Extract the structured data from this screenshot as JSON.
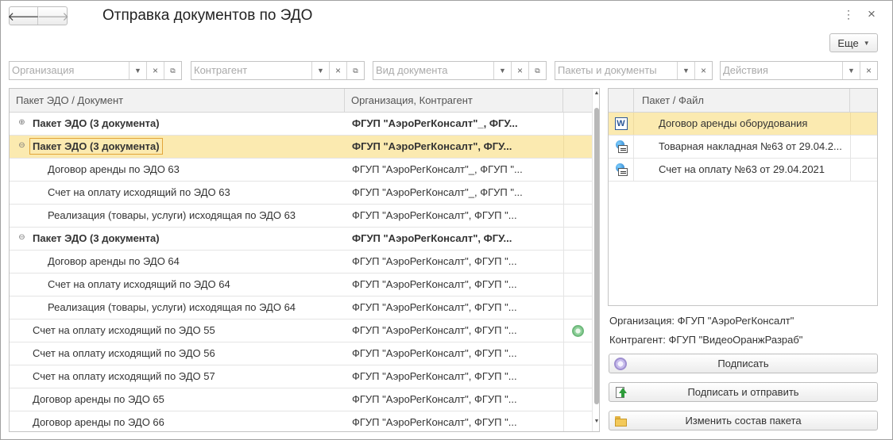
{
  "window": {
    "title": "Отправка документов по ЭДО",
    "back_icon": "🡐",
    "forward_icon": "🡒",
    "menu_icon": "⋮",
    "close_icon": "×"
  },
  "toolbar": {
    "more_label": "Еще",
    "more_caret": "▼"
  },
  "filters": [
    {
      "placeholder": "Организация",
      "has_open": true
    },
    {
      "placeholder": "Контрагент",
      "has_open": true
    },
    {
      "placeholder": "Вид документа",
      "has_open": true
    },
    {
      "placeholder": "Пакеты и документы",
      "has_open": false
    },
    {
      "placeholder": "Действия",
      "has_open": false
    }
  ],
  "filter_glyphs": {
    "dropdown": "▼",
    "clear": "×",
    "open": "⧉"
  },
  "main_table": {
    "columns": [
      "Пакет ЭДО / Документ",
      "Организация, Контрагент"
    ],
    "rows": [
      {
        "doc": "Пакет ЭДО (3 документа)",
        "org": "ФГУП \"АэроРегКонсалт\"_, ФГУ...",
        "level": 0,
        "bold": true,
        "expander": "⊕",
        "selected": false,
        "focused": false,
        "signed": false
      },
      {
        "doc": "Пакет ЭДО (3 документа)",
        "org": "ФГУП \"АэроРегКонсалт\", ФГУ...",
        "level": 0,
        "bold": true,
        "expander": "⊖",
        "selected": true,
        "focused": true,
        "signed": false
      },
      {
        "doc": "Договор аренды по ЭДО 63",
        "org": "ФГУП \"АэроРегКонсалт\"_, ФГУП \"...",
        "level": 2,
        "bold": false,
        "expander": "",
        "selected": false,
        "focused": false,
        "signed": false
      },
      {
        "doc": "Счет на оплату исходящий по ЭДО 63",
        "org": "ФГУП \"АэроРегКонсалт\"_, ФГУП \"...",
        "level": 2,
        "bold": false,
        "expander": "",
        "selected": false,
        "focused": false,
        "signed": false
      },
      {
        "doc": "Реализация (товары, услуги) исходящая по ЭДО 63",
        "org": "ФГУП \"АэроРегКонсалт\", ФГУП \"...",
        "level": 2,
        "bold": false,
        "expander": "",
        "selected": false,
        "focused": false,
        "signed": false
      },
      {
        "doc": "Пакет ЭДО (3 документа)",
        "org": "ФГУП \"АэроРегКонсалт\", ФГУ...",
        "level": 0,
        "bold": true,
        "expander": "⊖",
        "selected": false,
        "focused": false,
        "signed": false
      },
      {
        "doc": "Договор аренды по ЭДО 64",
        "org": "ФГУП \"АэроРегКонсалт\", ФГУП \"...",
        "level": 2,
        "bold": false,
        "expander": "",
        "selected": false,
        "focused": false,
        "signed": false
      },
      {
        "doc": "Счет на оплату исходящий по ЭДО 64",
        "org": "ФГУП \"АэроРегКонсалт\", ФГУП \"...",
        "level": 2,
        "bold": false,
        "expander": "",
        "selected": false,
        "focused": false,
        "signed": false
      },
      {
        "doc": "Реализация (товары, услуги) исходящая по ЭДО 64",
        "org": "ФГУП \"АэроРегКонсалт\", ФГУП \"...",
        "level": 2,
        "bold": false,
        "expander": "",
        "selected": false,
        "focused": false,
        "signed": false
      },
      {
        "doc": "Счет на оплату исходящий по ЭДО 55",
        "org": "ФГУП \"АэроРегКонсалт\", ФГУП \"...",
        "level": 1,
        "bold": false,
        "expander": "",
        "selected": false,
        "focused": false,
        "signed": true
      },
      {
        "doc": "Счет на оплату исходящий по ЭДО 56",
        "org": "ФГУП \"АэроРегКонсалт\", ФГУП \"...",
        "level": 1,
        "bold": false,
        "expander": "",
        "selected": false,
        "focused": false,
        "signed": false
      },
      {
        "doc": "Счет на оплату исходящий по ЭДО 57",
        "org": "ФГУП \"АэроРегКонсалт\", ФГУП \"...",
        "level": 1,
        "bold": false,
        "expander": "",
        "selected": false,
        "focused": false,
        "signed": false
      },
      {
        "doc": "Договор аренды по ЭДО 65",
        "org": "ФГУП \"АэроРегКонсалт\", ФГУП \"...",
        "level": 1,
        "bold": false,
        "expander": "",
        "selected": false,
        "focused": false,
        "signed": false
      },
      {
        "doc": "Договор аренды по ЭДО 66",
        "org": "ФГУП \"АэроРегКонсалт\", ФГУП \"...",
        "level": 1,
        "bold": false,
        "expander": "",
        "selected": false,
        "focused": false,
        "signed": false
      }
    ]
  },
  "package_panel": {
    "column": "Пакет / Файл",
    "files": [
      {
        "name": "Договор аренды оборудования",
        "icon": "word-document-icon",
        "selected": true
      },
      {
        "name": "Товарная накладная №63 от 29.04.2...",
        "icon": "edo-document-icon",
        "selected": false
      },
      {
        "name": "Счет на оплату №63 от 29.04.2021",
        "icon": "edo-document-icon",
        "selected": false
      }
    ],
    "word_glyph": "W"
  },
  "info": {
    "organization": "Организация: ФГУП \"АэроРегКонсалт\"",
    "counterparty": "Контрагент: ФГУП \"ВидеоОранжРазраб\""
  },
  "actions": {
    "sign": "Подписать",
    "sign_and_send": "Подписать и отправить",
    "change_package": "Изменить состав пакета"
  },
  "scrollbar": {
    "up": "▲",
    "down": "▼"
  },
  "colors": {
    "selection": "#fbeab0",
    "focus_border": "#e2a53a",
    "signed_icon": "#6db87a"
  }
}
